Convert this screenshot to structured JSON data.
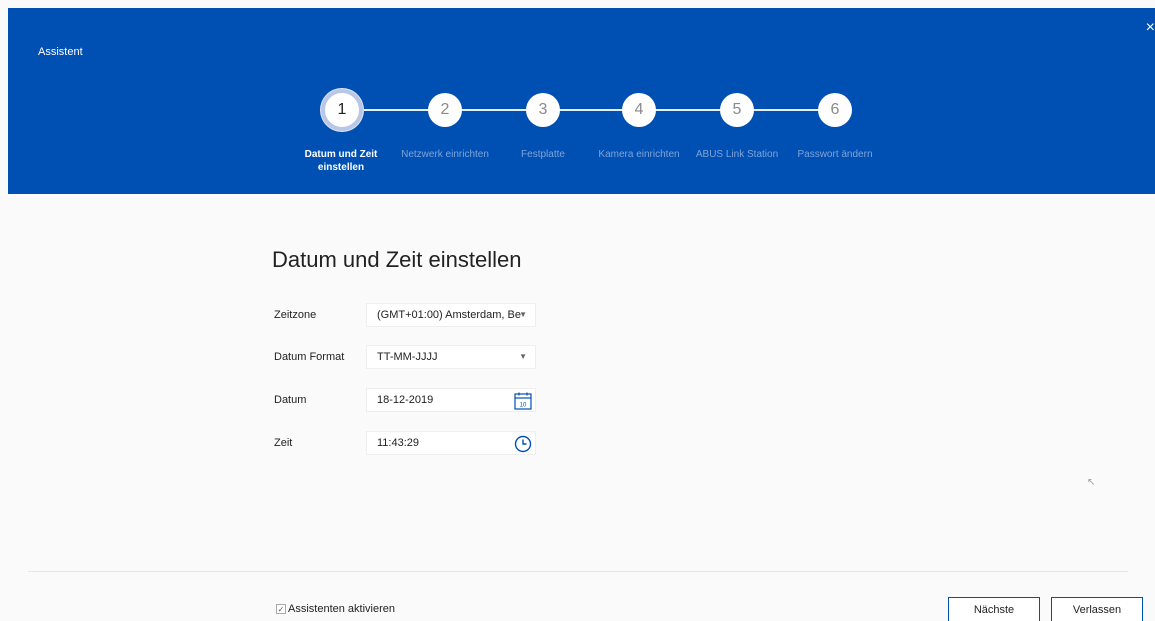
{
  "window": {
    "title": "Assistent",
    "close_glyph": "×"
  },
  "steps": [
    {
      "number": "1",
      "label": "Datum und Zeit einstellen",
      "active": true
    },
    {
      "number": "2",
      "label": "Netzwerk einrichten",
      "active": false
    },
    {
      "number": "3",
      "label": "Festplatte",
      "active": false
    },
    {
      "number": "4",
      "label": "Kamera einrichten",
      "active": false
    },
    {
      "number": "5",
      "label": "ABUS Link Station",
      "active": false
    },
    {
      "number": "6",
      "label": "Passwort ändern",
      "active": false
    }
  ],
  "form": {
    "title": "Datum und Zeit einstellen",
    "timezone": {
      "label": "Zeitzone",
      "value": "(GMT+01:00) Amsterdam, Be"
    },
    "date_format": {
      "label": "Datum Format",
      "value": "TT-MM-JJJJ"
    },
    "date": {
      "label": "Datum",
      "value": "18-12-2019",
      "calendar_day": "10"
    },
    "time": {
      "label": "Zeit",
      "value": "11:43:29"
    }
  },
  "footer": {
    "checkbox_label": "Assistenten aktivieren",
    "checkbox_checked": true,
    "next_button": "Nächste",
    "exit_button": "Verlassen"
  },
  "colors": {
    "header_bg": "#0050b3",
    "button_border": "#0050b3"
  }
}
